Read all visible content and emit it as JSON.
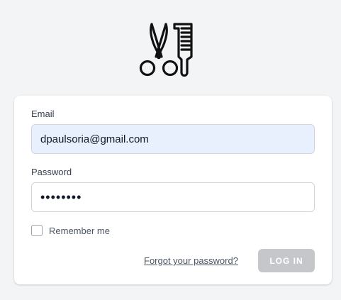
{
  "logo": {
    "icon": "scissors-and-comb-icon"
  },
  "form": {
    "email_label": "Email",
    "email_value": "dpaulsoria@gmail.com",
    "password_label": "Password",
    "password_value": "••••••••",
    "remember_label": "Remember me",
    "forgot_label": "Forgot your password?",
    "login_label": "LOG IN"
  },
  "colors": {
    "background": "#f3f4f6",
    "autofill": "#e8f0fe",
    "button_disabled": "#c5c7cb"
  }
}
